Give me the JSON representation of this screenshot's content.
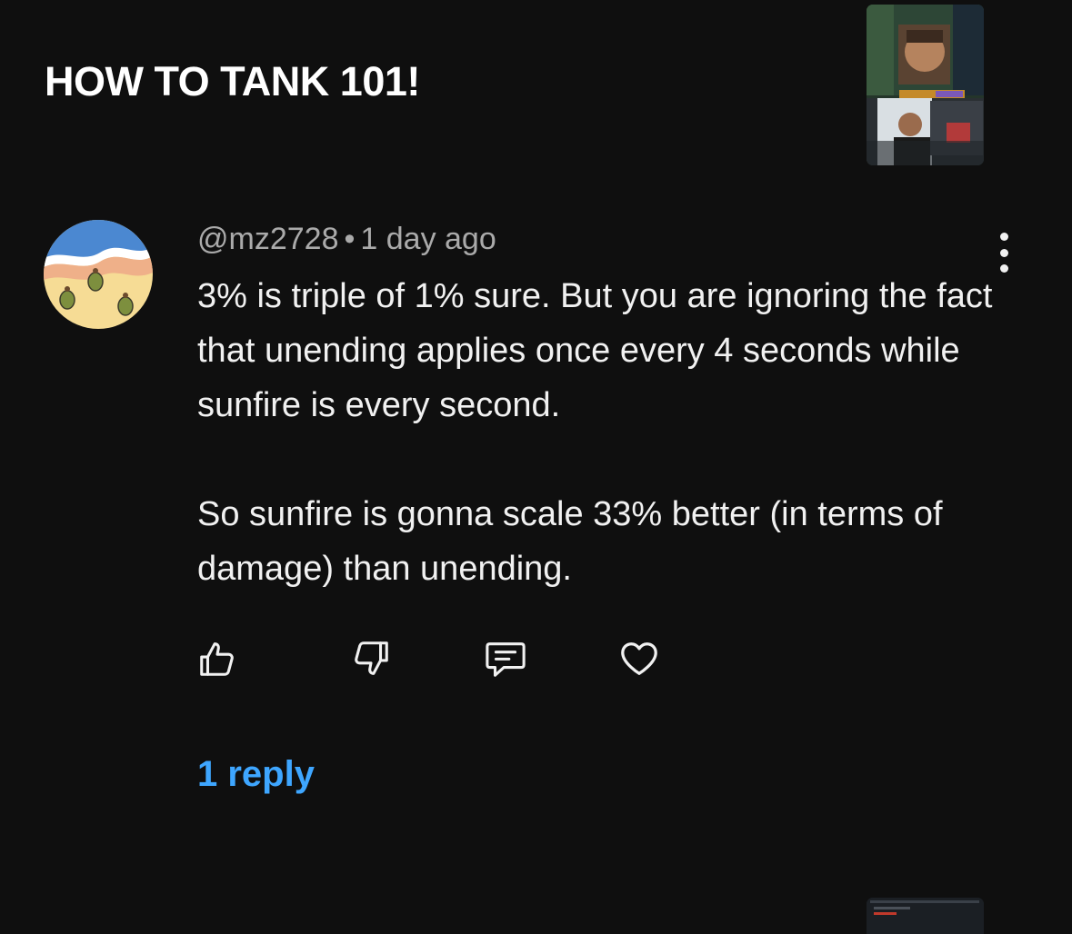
{
  "video": {
    "title": "HOW TO TANK 101!"
  },
  "comment": {
    "author": "@mz2728",
    "separator": "•",
    "timestamp": "1 day ago",
    "paragraphs": [
      "3% is triple of 1% sure. But you are ignoring the fact that unending applies once every 4 seconds while sunfire is every second.",
      "So sunfire is gonna scale 33% better (in terms of damage) than unending."
    ],
    "actions": [
      {
        "name": "like",
        "icon": "thumbs-up-icon"
      },
      {
        "name": "dislike",
        "icon": "thumbs-down-icon"
      },
      {
        "name": "reply",
        "icon": "comment-icon"
      },
      {
        "name": "heart",
        "icon": "heart-icon"
      }
    ],
    "more_icon": "vertical-ellipsis-icon",
    "replies_label": "1 reply"
  },
  "colors": {
    "background": "#0f0f0f",
    "text_primary": "#f1f1f1",
    "text_secondary": "#aaaaaa",
    "link": "#3ea6ff"
  }
}
